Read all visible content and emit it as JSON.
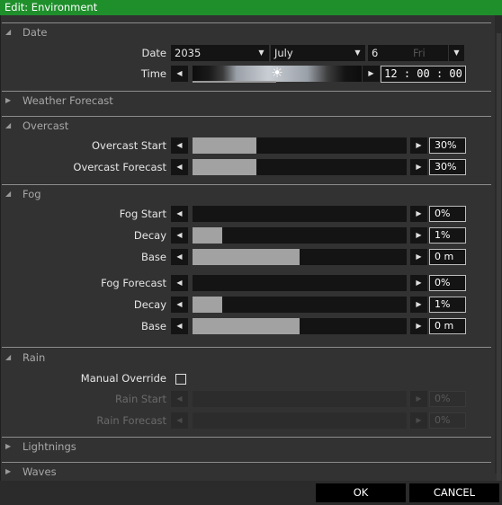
{
  "window": {
    "title": "Edit: Environment"
  },
  "sections": {
    "date": {
      "label": "Date"
    },
    "weather_forecast": {
      "label": "Weather Forecast"
    },
    "overcast": {
      "label": "Overcast"
    },
    "fog": {
      "label": "Fog"
    },
    "rain": {
      "label": "Rain"
    },
    "lightnings": {
      "label": "Lightnings"
    },
    "waves": {
      "label": "Waves"
    }
  },
  "date": {
    "label": "Date",
    "year": "2035",
    "month": "July",
    "day": "6",
    "weekday": "Fri"
  },
  "time": {
    "label": "Time",
    "value": "12 : 00 : 00",
    "day_fraction": 0.5
  },
  "overcast": {
    "start": {
      "label": "Overcast Start",
      "value": "30%",
      "fraction": 0.3
    },
    "forecast": {
      "label": "Overcast Forecast",
      "value": "30%",
      "fraction": 0.3
    }
  },
  "fog": {
    "start": {
      "label": "Fog Start",
      "value": "0%",
      "fraction": 0.0
    },
    "decay": {
      "label": "Decay",
      "value": "1%",
      "fraction": 0.14
    },
    "base": {
      "label": "Base",
      "value": "0 m",
      "fraction": 0.5
    },
    "forecast": {
      "label": "Fog Forecast",
      "value": "0%",
      "fraction": 0.0
    },
    "forecast_decay": {
      "label": "Decay",
      "value": "1%",
      "fraction": 0.14
    },
    "forecast_base": {
      "label": "Base",
      "value": "0 m",
      "fraction": 0.5
    }
  },
  "rain": {
    "manual_override": {
      "label": "Manual Override",
      "checked": false
    },
    "start": {
      "label": "Rain Start",
      "value": "0%",
      "fraction": 0.0
    },
    "forecast": {
      "label": "Rain Forecast",
      "value": "0%",
      "fraction": 0.0
    }
  },
  "buttons": {
    "ok": "OK",
    "cancel": "CANCEL"
  },
  "icons": {
    "expanded": "triangle-down",
    "collapsed": "triangle-right",
    "left": "arrow-left",
    "right": "arrow-right",
    "dropdown": "arrow-down",
    "sun": "sun"
  },
  "colors": {
    "titlebar": "#1f8f2c",
    "panel": "#323232",
    "fill": "#a2a2a2"
  }
}
